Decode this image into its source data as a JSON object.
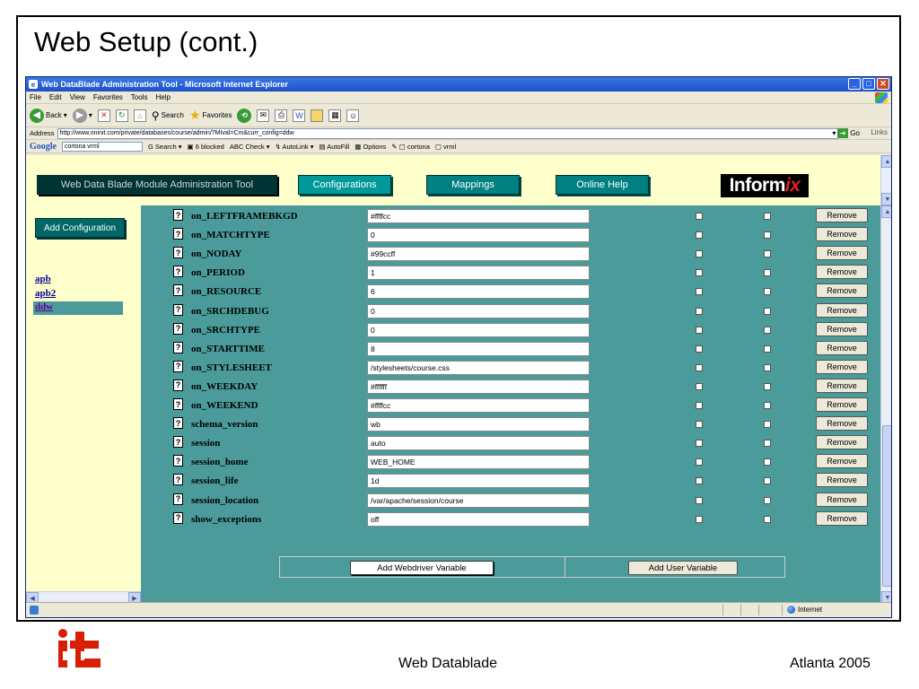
{
  "slide": {
    "title": "Web Setup (cont.)",
    "footer_center": "Web Datablade",
    "footer_right": "Atlanta 2005"
  },
  "window": {
    "title": "Web DataBlade Administration Tool - Microsoft Internet Explorer",
    "menu": [
      "File",
      "Edit",
      "View",
      "Favorites",
      "Tools",
      "Help"
    ],
    "toolbar": {
      "back": "Back",
      "search": "Search",
      "favorites": "Favorites"
    },
    "address_label": "Address",
    "address_url": "http://www.oninit.com/private/databases/course/admin/?MIval=Cm&curr_config=ddw",
    "go_label": "Go",
    "links_label": "Links",
    "google": {
      "logo": "Google",
      "query": "cortona vrml",
      "search": "Search",
      "blocked": "6 blocked",
      "check": "Check",
      "autolink": "AutoLink",
      "autofill": "AutoFill",
      "options": "Options",
      "term1": "cortona",
      "term2": "vrml"
    },
    "status_zone": "Internet"
  },
  "topframe": {
    "title_button": "Web Data Blade Module Administration Tool",
    "nav": [
      "Configurations",
      "Mappings",
      "Online Help"
    ],
    "logo_main": "Inform",
    "logo_i": "i",
    "logo_x": "x"
  },
  "leftframe": {
    "add_config": "Add Configuration",
    "configs": [
      "apb",
      "apb2",
      "ddw"
    ]
  },
  "variables": [
    {
      "name": "on_LEFTFRAMEBKGD",
      "value": "#ffffcc"
    },
    {
      "name": "on_MATCHTYPE",
      "value": "0"
    },
    {
      "name": "on_NODAY",
      "value": "#99ccff"
    },
    {
      "name": "on_PERIOD",
      "value": "1"
    },
    {
      "name": "on_RESOURCE",
      "value": "6"
    },
    {
      "name": "on_SRCHDEBUG",
      "value": "0"
    },
    {
      "name": "on_SRCHTYPE",
      "value": "0"
    },
    {
      "name": "on_STARTTIME",
      "value": "8"
    },
    {
      "name": "on_STYLESHEET",
      "value": "/stylesheets/course.css"
    },
    {
      "name": "on_WEEKDAY",
      "value": "#ffffff"
    },
    {
      "name": "on_WEEKEND",
      "value": "#ffffcc"
    },
    {
      "name": "schema_version",
      "value": "wb"
    },
    {
      "name": "session",
      "value": "auto"
    },
    {
      "name": "session_home",
      "value": "WEB_HOME"
    },
    {
      "name": "session_life",
      "value": "1d"
    },
    {
      "name": "session_location",
      "value": "/var/apache/session/course"
    },
    {
      "name": "show_exceptions",
      "value": "off"
    }
  ],
  "row_labels": {
    "help": "?",
    "remove": "Remove"
  },
  "bottom_buttons": {
    "add_webdriver": "Add Webdriver Variable",
    "add_user": "Add User Variable"
  }
}
